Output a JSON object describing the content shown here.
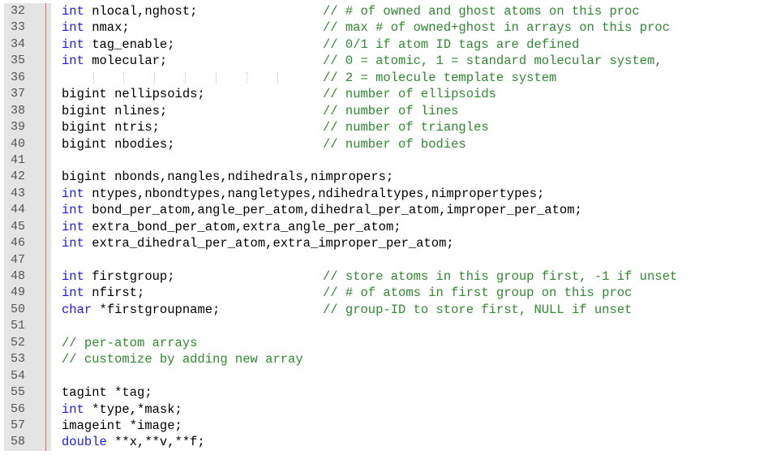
{
  "colors": {
    "keyword": "#1a1aff",
    "comment": "#2e8b2e",
    "text": "#000000",
    "gutter": "#e4e4e4",
    "line_number": "#555555",
    "margin_line": "#e06666"
  },
  "lines": [
    {
      "n": "32",
      "kw": "int",
      "code": " nlocal,nghost;",
      "comment": "// # of owned and ghost atoms on this proc"
    },
    {
      "n": "33",
      "kw": "int",
      "code": " nmax;",
      "comment": "// max # of owned+ghost in arrays on this proc"
    },
    {
      "n": "34",
      "kw": "int",
      "code": " tag_enable;",
      "comment": "// 0/1 if atom ID tags are defined"
    },
    {
      "n": "35",
      "kw": "int",
      "code": " molecular;",
      "comment": "// 0 = atomic, 1 = standard molecular system,"
    },
    {
      "n": "36",
      "kw": "",
      "code": "",
      "comment": "// 2 = molecule template system"
    },
    {
      "n": "37",
      "kw": "",
      "code": "bigint nellipsoids;",
      "comment": "// number of ellipsoids"
    },
    {
      "n": "38",
      "kw": "",
      "code": "bigint nlines;",
      "comment": "// number of lines"
    },
    {
      "n": "39",
      "kw": "",
      "code": "bigint ntris;",
      "comment": "// number of triangles"
    },
    {
      "n": "40",
      "kw": "",
      "code": "bigint nbodies;",
      "comment": "// number of bodies"
    },
    {
      "n": "41",
      "kw": "",
      "code": "",
      "comment": ""
    },
    {
      "n": "42",
      "kw": "",
      "code": "bigint nbonds,nangles,ndihedrals,nimpropers;",
      "comment": ""
    },
    {
      "n": "43",
      "kw": "int",
      "code": " ntypes,nbondtypes,nangletypes,ndihedraltypes,nimpropertypes;",
      "comment": ""
    },
    {
      "n": "44",
      "kw": "int",
      "code": " bond_per_atom,angle_per_atom,dihedral_per_atom,improper_per_atom;",
      "comment": ""
    },
    {
      "n": "45",
      "kw": "int",
      "code": " extra_bond_per_atom,extra_angle_per_atom;",
      "comment": ""
    },
    {
      "n": "46",
      "kw": "int",
      "code": " extra_dihedral_per_atom,extra_improper_per_atom;",
      "comment": ""
    },
    {
      "n": "47",
      "kw": "",
      "code": "",
      "comment": ""
    },
    {
      "n": "48",
      "kw": "int",
      "code": " firstgroup;",
      "comment": "// store atoms in this group first, -1 if unset"
    },
    {
      "n": "49",
      "kw": "int",
      "code": " nfirst;",
      "comment": "// # of atoms in first group on this proc"
    },
    {
      "n": "50",
      "kw": "char",
      "code": " *firstgroupname;",
      "comment": "// group-ID to store first, NULL if unset"
    },
    {
      "n": "51",
      "kw": "",
      "code": "",
      "comment": ""
    },
    {
      "n": "52",
      "kw": "",
      "cm": "// per-atom arrays",
      "code": "",
      "comment": ""
    },
    {
      "n": "53",
      "kw": "",
      "cm": "// customize by adding new array",
      "code": "",
      "comment": ""
    },
    {
      "n": "54",
      "kw": "",
      "code": "",
      "comment": ""
    },
    {
      "n": "55",
      "kw": "",
      "code": "tagint *tag;",
      "comment": ""
    },
    {
      "n": "56",
      "kw": "int",
      "code": " *type,*mask;",
      "comment": ""
    },
    {
      "n": "57",
      "kw": "",
      "code": "imageint *image;",
      "comment": ""
    },
    {
      "n": "58",
      "kw": "double",
      "code": " **x,**v,**f;",
      "comment": ""
    }
  ]
}
